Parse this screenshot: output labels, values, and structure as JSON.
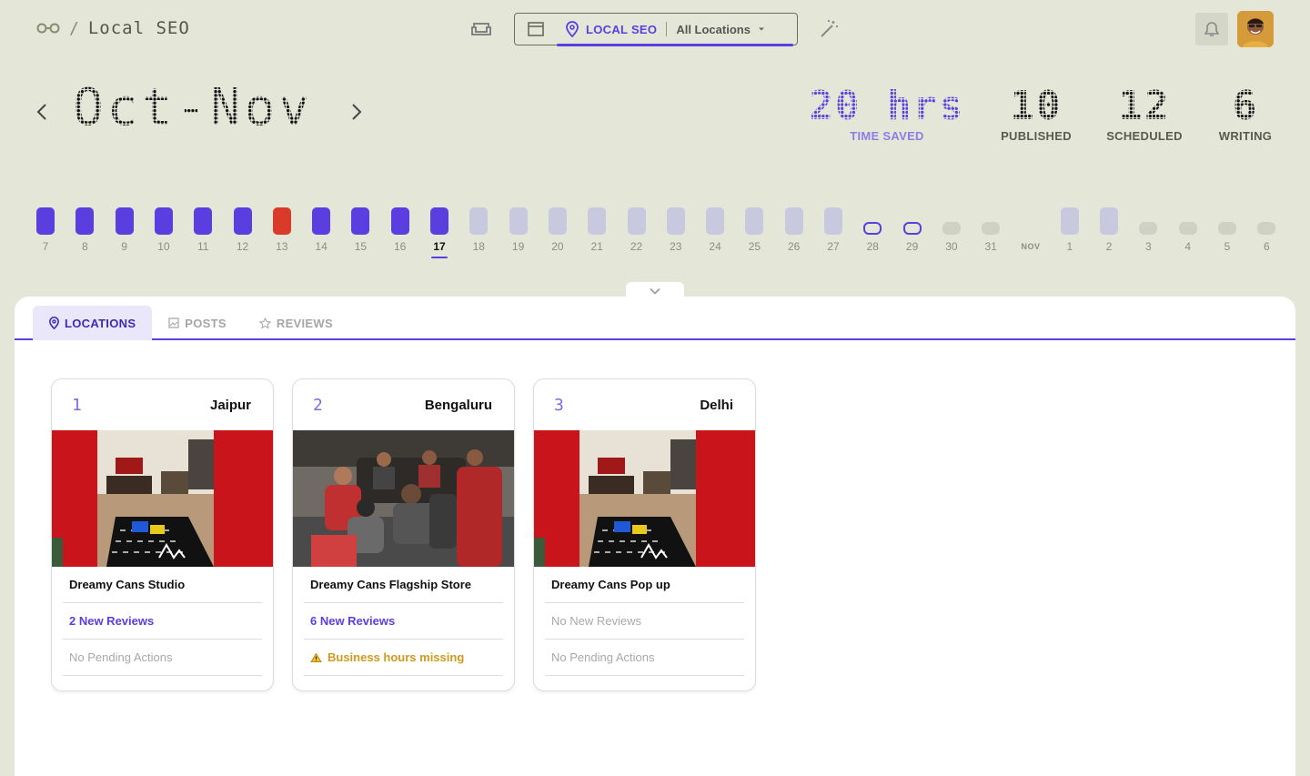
{
  "header": {
    "brand": "Local SEO",
    "brand_separator": "/",
    "switcher": {
      "active_label": "LOCAL SEO",
      "locations_label": "All Locations"
    }
  },
  "period": {
    "label": "Oct-Nov",
    "stats": [
      {
        "value": "20 hrs",
        "label": "TIME SAVED"
      },
      {
        "value": "10",
        "label": "PUBLISHED"
      },
      {
        "value": "12",
        "label": "SCHEDULED"
      },
      {
        "value": "6",
        "label": "WRITING"
      }
    ]
  },
  "timeline": {
    "month_marker": "NOV",
    "days": [
      {
        "d": "7",
        "status": "published"
      },
      {
        "d": "8",
        "status": "published"
      },
      {
        "d": "9",
        "status": "published"
      },
      {
        "d": "10",
        "status": "published"
      },
      {
        "d": "11",
        "status": "published"
      },
      {
        "d": "12",
        "status": "published"
      },
      {
        "d": "13",
        "status": "failed"
      },
      {
        "d": "14",
        "status": "published"
      },
      {
        "d": "15",
        "status": "published"
      },
      {
        "d": "16",
        "status": "published"
      },
      {
        "d": "17",
        "status": "published",
        "today": true
      },
      {
        "d": "18",
        "status": "scheduled"
      },
      {
        "d": "19",
        "status": "scheduled"
      },
      {
        "d": "20",
        "status": "scheduled"
      },
      {
        "d": "21",
        "status": "scheduled"
      },
      {
        "d": "22",
        "status": "scheduled"
      },
      {
        "d": "23",
        "status": "scheduled"
      },
      {
        "d": "24",
        "status": "scheduled"
      },
      {
        "d": "25",
        "status": "scheduled"
      },
      {
        "d": "26",
        "status": "scheduled"
      },
      {
        "d": "27",
        "status": "scheduled"
      },
      {
        "d": "28",
        "status": "writing"
      },
      {
        "d": "29",
        "status": "writing"
      },
      {
        "d": "30",
        "status": "empty"
      },
      {
        "d": "31",
        "status": "empty"
      },
      {
        "d": "1",
        "status": "scheduled"
      },
      {
        "d": "2",
        "status": "scheduled"
      },
      {
        "d": "3",
        "status": "empty"
      },
      {
        "d": "4",
        "status": "empty"
      },
      {
        "d": "5",
        "status": "empty"
      },
      {
        "d": "6",
        "status": "empty"
      }
    ]
  },
  "tabs": [
    "LOCATIONS",
    "POSTS",
    "REVIEWS"
  ],
  "locations": [
    {
      "index": "1",
      "city": "Jaipur",
      "name": "Dreamy Cans Studio",
      "reviews": "2 New Reviews",
      "reviews_state": "active",
      "actions": "No Pending Actions",
      "actions_state": "muted",
      "photo": "studio"
    },
    {
      "index": "2",
      "city": "Bengaluru",
      "name": "Dreamy Cans Flagship Store",
      "reviews": "6 New Reviews",
      "reviews_state": "active",
      "actions": "Business hours missing",
      "actions_state": "warn",
      "photo": "group"
    },
    {
      "index": "3",
      "city": "Delhi",
      "name": "Dreamy Cans Pop up",
      "reviews": "No New Reviews",
      "reviews_state": "muted",
      "actions": "No Pending Actions",
      "actions_state": "muted",
      "photo": "studio"
    }
  ],
  "colors": {
    "accent": "#5b3ee0",
    "failed": "#d93a2a",
    "scheduled": "#c8c8de",
    "warn": "#d09a1a",
    "background": "#e4e6d8"
  }
}
